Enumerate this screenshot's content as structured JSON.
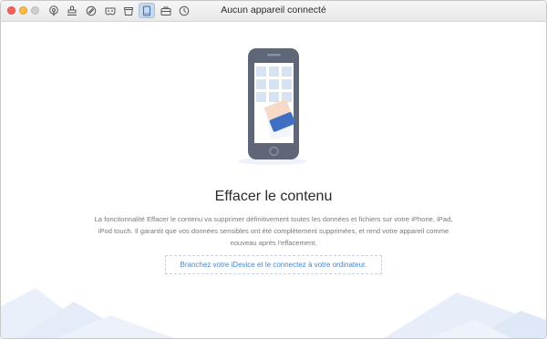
{
  "window": {
    "title": "Aucun appareil connecté"
  },
  "toolbar": {
    "tools": [
      {
        "icon": "podcast-icon",
        "active": false
      },
      {
        "icon": "stamp-icon",
        "active": false
      },
      {
        "icon": "cleaner-icon",
        "active": false
      },
      {
        "icon": "mask-icon",
        "active": false
      },
      {
        "icon": "bucket-icon",
        "active": false
      },
      {
        "icon": "tablet-icon",
        "active": true
      },
      {
        "icon": "briefcase-icon",
        "active": false
      },
      {
        "icon": "history-icon",
        "active": false
      }
    ]
  },
  "main": {
    "heading": "Effacer le contenu",
    "description": "La fonctionnalité Effacer le contenu va supprimer définitivement toutes les données et fichiers sur votre iPhone, iPad, iPod touch. Il garantit que vos données sensibles ont été complètement supprimées, et rend votre appareil comme nouveau après l'effacement.",
    "connect_prompt": "Branchez votre iDevice et le connectez à votre ordinateur."
  },
  "colors": {
    "accent": "#4a86c8",
    "phone_body": "#5e6678",
    "tile": "#d6e3f3",
    "eraser_top": "#f7d9c8",
    "eraser_bottom": "#3f6fc2",
    "mountain": "#e3ecf8"
  }
}
